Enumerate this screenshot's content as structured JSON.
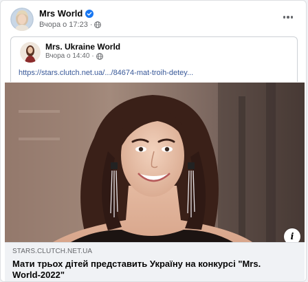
{
  "post": {
    "author": "Mrs World",
    "time": "Вчора о 17:23",
    "separator": "·"
  },
  "shared_post": {
    "author": "Mrs. Ukraine World",
    "time": "Вчора о 14:40",
    "separator": "·",
    "link": "https://stars.clutch.net.ua/.../84674-mat-troih-detey..."
  },
  "link_preview": {
    "domain": "STARS.CLUTCH.NET.UA",
    "title": "Мати трьох дітей представить Україну на конкурсі \"Mrs. World-2022\""
  },
  "icons": {
    "verified": "verified-badge-icon",
    "privacy": "globe-icon",
    "more": "more-options-icon",
    "info": "info-icon"
  },
  "colors": {
    "verified": "#1877f2",
    "link": "#385898",
    "meta": "#65676b"
  }
}
